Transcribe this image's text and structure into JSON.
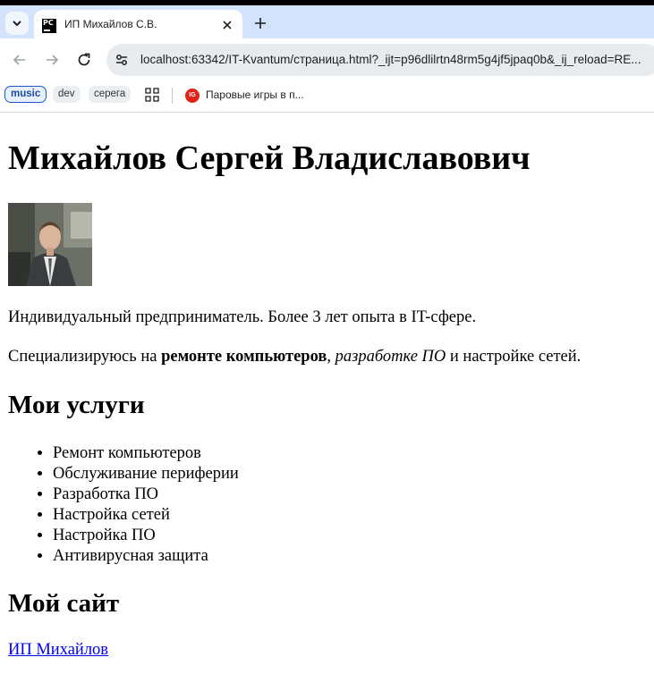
{
  "browser": {
    "tab": {
      "title": "ИП Михайлов С.В.",
      "favicon_text": "PC"
    },
    "url": "localhost:63342/IT-Kvantum/страница.html?_ijt=p96dlilrtn48rm5g4jf5jpaq0b&_ij_reload=RE...",
    "bookmarks": [
      {
        "label": "music"
      },
      {
        "label": "dev"
      },
      {
        "label": "серега"
      }
    ],
    "bookmark_link": {
      "label": "Паровые игры в п...",
      "icon_text": "IG"
    },
    "icons": {
      "tab_list": "chevron-down-icon",
      "close": "close-icon",
      "new_tab": "plus-icon",
      "back": "arrow-left-icon",
      "forward": "arrow-right-icon",
      "reload": "reload-icon",
      "site_info": "tune-icon",
      "apps": "apps-grid-icon"
    }
  },
  "page": {
    "title": "Михайлов Сергей Владиславович",
    "photo_alt": "portrait photo",
    "intro": "Индивидуальный предприниматель. Более 3 лет опыта в IT-сфере.",
    "spec": {
      "prefix": "Специализируюсь на ",
      "bold": "ремонте компьютеров",
      "comma": ", ",
      "italic": "разработке ПО",
      "suffix": " и настройке сетей."
    },
    "services_heading": "Мои услуги",
    "services": [
      "Ремонт компьютеров",
      "Обслуживание периферии",
      "Разработка ПО",
      "Настройка сетей",
      "Настройка ПО",
      "Антивирусная защита"
    ],
    "site_heading": "Мой сайт",
    "site_link": "ИП Михайлов"
  },
  "colors": {
    "tab_bar_bg": "#d3e3fd",
    "link": "#0000ee",
    "omnibox_bg": "#e8ebee"
  }
}
